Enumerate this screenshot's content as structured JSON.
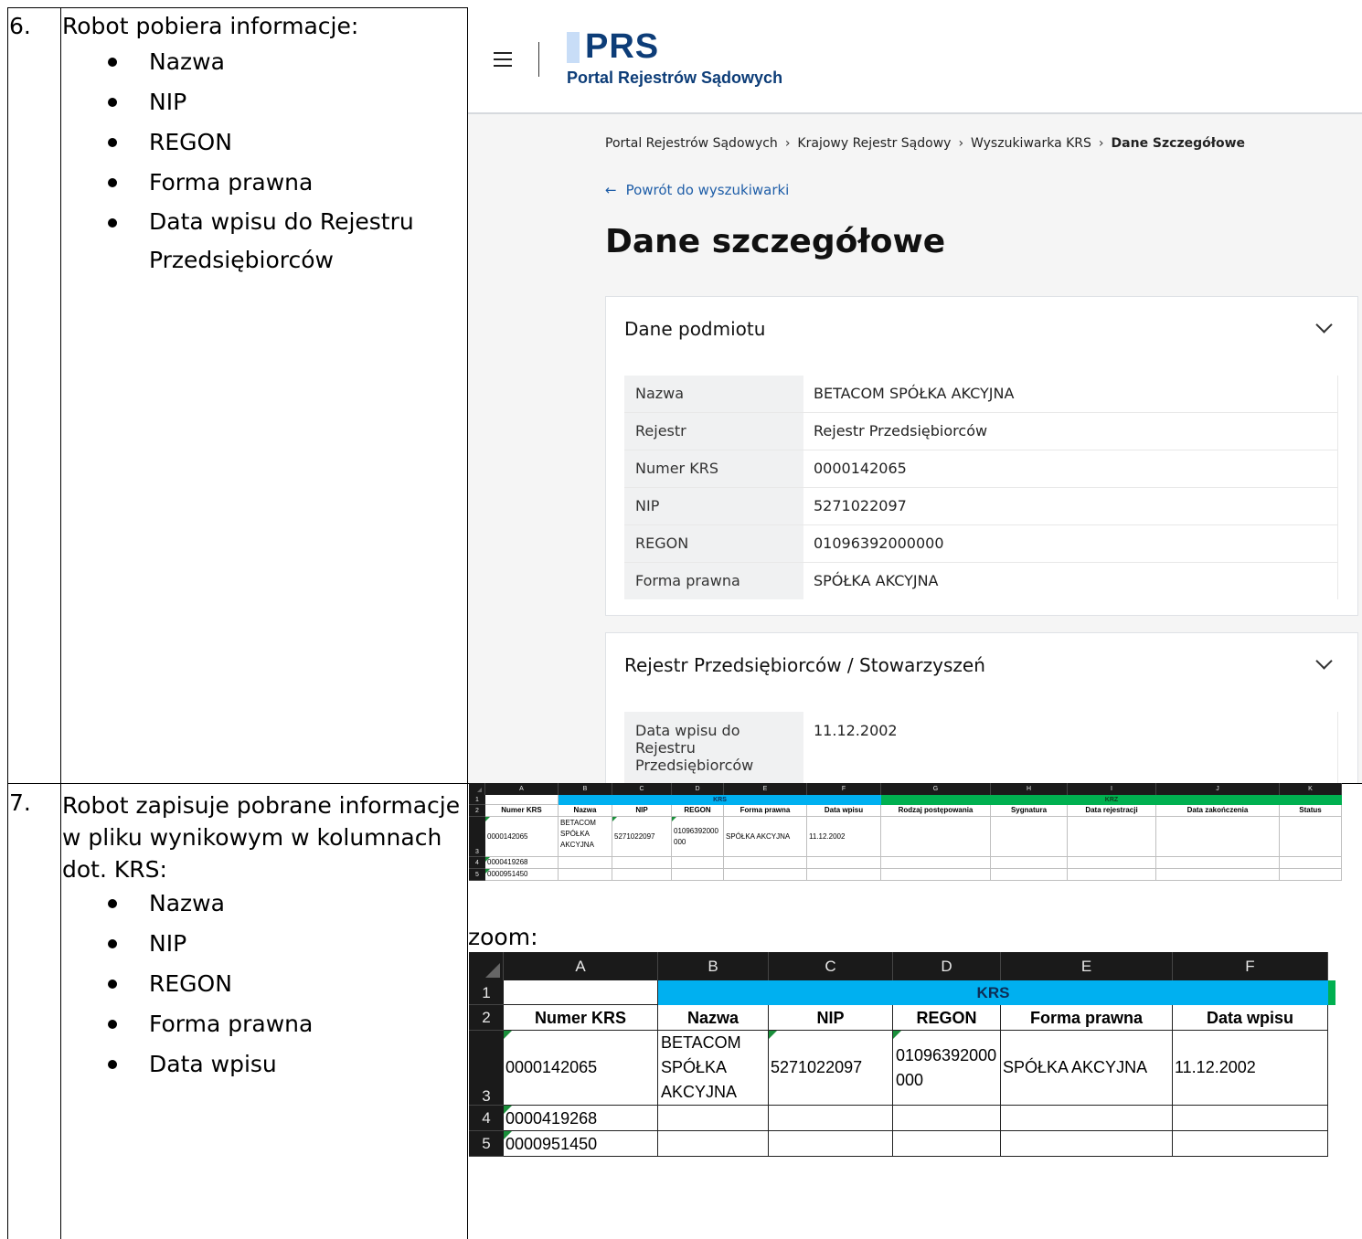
{
  "step6": {
    "number": "6.",
    "heading": "Robot pobiera informacje:",
    "bullets": [
      "Nazwa",
      "NIP",
      "REGON",
      "Forma prawna",
      "Data wpisu do Rejestru Przedsiębiorców"
    ]
  },
  "step7": {
    "number": "7.",
    "heading_lines": [
      "Robot zapisuje pobrane informacje",
      "w pliku wynikowym w kolumnach",
      "dot. KRS:"
    ],
    "bullets": [
      "Nazwa",
      "NIP",
      "REGON",
      "Forma prawna",
      "Data wpisu"
    ]
  },
  "portal": {
    "logo_short": "PRS",
    "logo_full": "Portal Rejestrów Sądowych",
    "breadcrumbs": [
      "Portal Rejestrów Sądowych",
      "Krajowy Rejestr Sądowy",
      "Wyszukiwarka KRS",
      "Dane Szczegółowe"
    ],
    "back_link": "Powrót do wyszukiwarki",
    "page_title": "Dane szczegółowe",
    "section1": {
      "title": "Dane podmiotu",
      "rows": [
        {
          "k": "Nazwa",
          "v": "BETACOM SPÓŁKA AKCYJNA"
        },
        {
          "k": "Rejestr",
          "v": "Rejestr Przedsiębiorców"
        },
        {
          "k": "Numer KRS",
          "v": "0000142065"
        },
        {
          "k": "NIP",
          "v": "5271022097"
        },
        {
          "k": "REGON",
          "v": "01096392000000"
        },
        {
          "k": "Forma prawna",
          "v": "SPÓŁKA AKCYJNA"
        }
      ]
    },
    "section2": {
      "title": "Rejestr Przedsiębiorców / Stowarzyszeń",
      "row_k_lines": [
        "Data wpisu do",
        "Rejestru",
        "Przedsiębiorców"
      ],
      "row_v": "11.12.2002"
    }
  },
  "excel_small": {
    "col_letters": [
      "A",
      "B",
      "C",
      "D",
      "E",
      "F",
      "G",
      "H",
      "I",
      "J",
      "K"
    ],
    "row_numbers": [
      "1",
      "2",
      "3",
      "4",
      "5"
    ],
    "group_krs": "KRS",
    "group_krz": "KRZ",
    "headers": [
      "Numer KRS",
      "Nazwa",
      "NIP",
      "REGON",
      "Forma prawna",
      "Data wpisu",
      "Rodzaj postępowania",
      "Sygnatura",
      "Data rejestracji",
      "Data zakończenia",
      "Status"
    ],
    "row3": {
      "krs": "0000142065",
      "nazwa_lines": [
        "BETACOM",
        "SPÓŁKA",
        "AKCYJNA"
      ],
      "nip": "5271022097",
      "regon_lines": [
        "01096392000",
        "000"
      ],
      "forma": "SPÓŁKA AKCYJNA",
      "data": "11.12.2002"
    },
    "row4_krs": "0000419268",
    "row5_krs": "0000951450"
  },
  "zoom_label": "zoom:",
  "excel_zoom": {
    "col_letters": [
      "A",
      "B",
      "C",
      "D",
      "E",
      "F"
    ],
    "row_numbers": [
      "1",
      "2",
      "3",
      "4",
      "5"
    ],
    "group_krs": "KRS",
    "headers": [
      "Numer KRS",
      "Nazwa",
      "NIP",
      "REGON",
      "Forma prawna",
      "Data wpisu"
    ],
    "row3": {
      "krs": "0000142065",
      "nazwa_lines": [
        "BETACOM",
        "SPÓŁKA",
        "AKCYJNA"
      ],
      "nip": "5271022097",
      "regon_lines": [
        "01096392000",
        "000"
      ],
      "forma": "SPÓŁKA AKCYJNA",
      "data": "11.12.2002"
    },
    "row4_krs": "0000419268",
    "row5_krs": "0000951450"
  },
  "colors": {
    "krs_blue": "#00b0f0",
    "krz_green": "#00b050",
    "prs_navy": "#0d3d78",
    "link_blue": "#1f5ea8"
  }
}
